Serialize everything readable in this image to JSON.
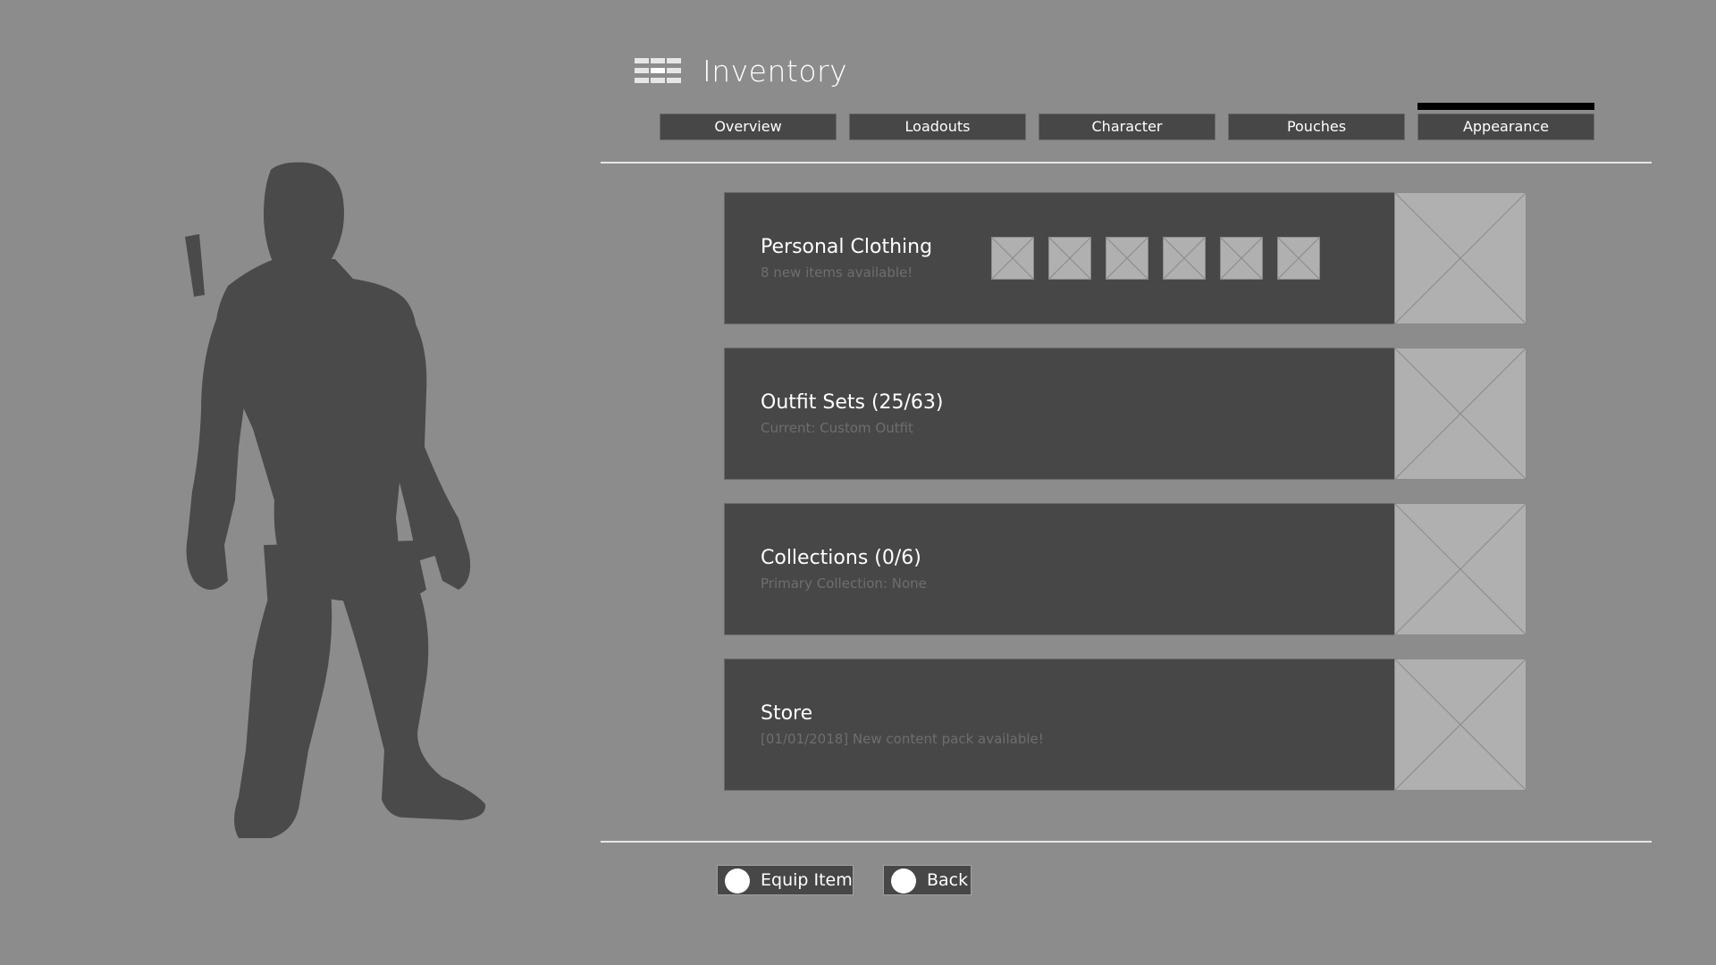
{
  "header": {
    "title": "Inventory",
    "menu_icon": "grid-menu-icon"
  },
  "tabs": [
    {
      "label": "Overview",
      "active": false
    },
    {
      "label": "Loadouts",
      "active": false
    },
    {
      "label": "Character",
      "active": false
    },
    {
      "label": "Pouches",
      "active": false
    },
    {
      "label": "Appearance",
      "active": true
    }
  ],
  "panels": [
    {
      "title": "Personal Clothing",
      "subtitle": "8 new items available!",
      "thumbnail_count": 6
    },
    {
      "title": "Outfit Sets (25/63)",
      "subtitle": "Current: Custom Outfit"
    },
    {
      "title": "Collections (0/6)",
      "subtitle": "Primary Collection: None"
    },
    {
      "title": "Store",
      "subtitle": "[01/01/2018] New content pack available!"
    }
  ],
  "actions": {
    "equip_label": "Equip Item",
    "back_label": "Back"
  },
  "colors": {
    "background": "#8c8c8c",
    "panel": "#474747",
    "placeholder": "#b0b0b0",
    "silhouette": "#4a4a4a",
    "active_indicator": "#000000"
  }
}
